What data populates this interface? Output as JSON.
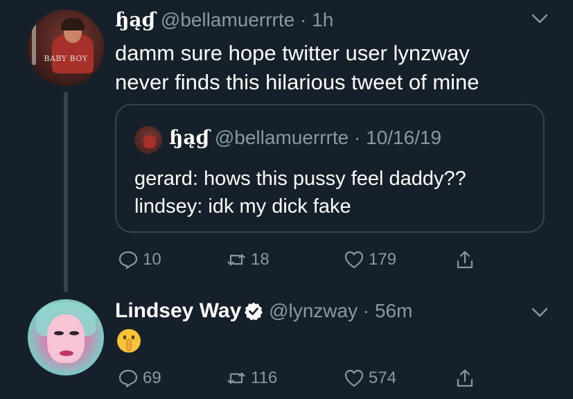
{
  "tweets": [
    {
      "name": "ɧąɠ",
      "handle": "@bellamuerrrte",
      "separator": "·",
      "time": "1h",
      "avatar_caption": "BABY BOY",
      "text_lines": [
        "damm sure hope twitter user lynzway",
        "never finds this hilarious tweet of mine"
      ],
      "quote": {
        "name": "ɧąɠ",
        "handle": "@bellamuerrrte",
        "separator": "·",
        "time": "10/16/19",
        "text_lines": [
          "gerard: hows this pussy feel daddy??",
          "lindsey: idk my dick fake"
        ]
      },
      "stats": {
        "replies": "10",
        "retweets": "18",
        "likes": "179"
      }
    },
    {
      "name": "Lindsey Way",
      "verified": true,
      "handle": "@lynzway",
      "separator": "·",
      "time": "56m",
      "emoji": "shushing-face",
      "stats": {
        "replies": "69",
        "retweets": "116",
        "likes": "574"
      }
    }
  ],
  "colors": {
    "background": "#15202b",
    "secondary_text": "#8899a6",
    "border": "#38444d",
    "verified": "#ffffff"
  },
  "icons": [
    "reply-icon",
    "retweet-icon",
    "like-icon",
    "share-icon",
    "chevron-down-icon",
    "verified-badge-icon"
  ]
}
